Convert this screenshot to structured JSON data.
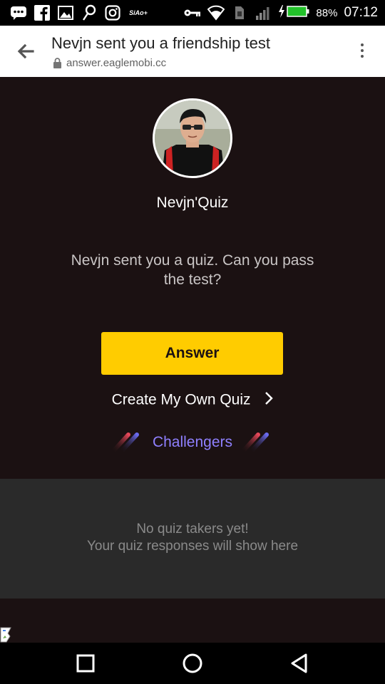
{
  "status_bar": {
    "battery": "88%",
    "time": "07:12",
    "carrier_icon_text": "SiAo+",
    "icons": [
      "chat-icon",
      "facebook-icon",
      "gallery-icon",
      "maps-icon",
      "instagram-icon",
      "key-icon",
      "wifi-icon",
      "sim-icon",
      "signal-icon",
      "charging-icon",
      "battery-icon"
    ]
  },
  "browser": {
    "page_title": "Nevjn sent you a friendship test",
    "url": "answer.eaglemobi.cc"
  },
  "quiz": {
    "name": "Nevjn'Quiz",
    "prompt": "Nevjn sent you a quiz. Can you pass the test?",
    "answer_label": "Answer",
    "create_label": "Create My Own Quiz",
    "challengers_label": "Challengers"
  },
  "takers": {
    "line1": "No quiz takers yet!",
    "line2": "Your quiz responses will show here"
  },
  "colors": {
    "background": "#1b1112",
    "accent_yellow": "#ffcc00",
    "challengers_purple": "#8f80ff",
    "panel": "#2a2a2a"
  }
}
